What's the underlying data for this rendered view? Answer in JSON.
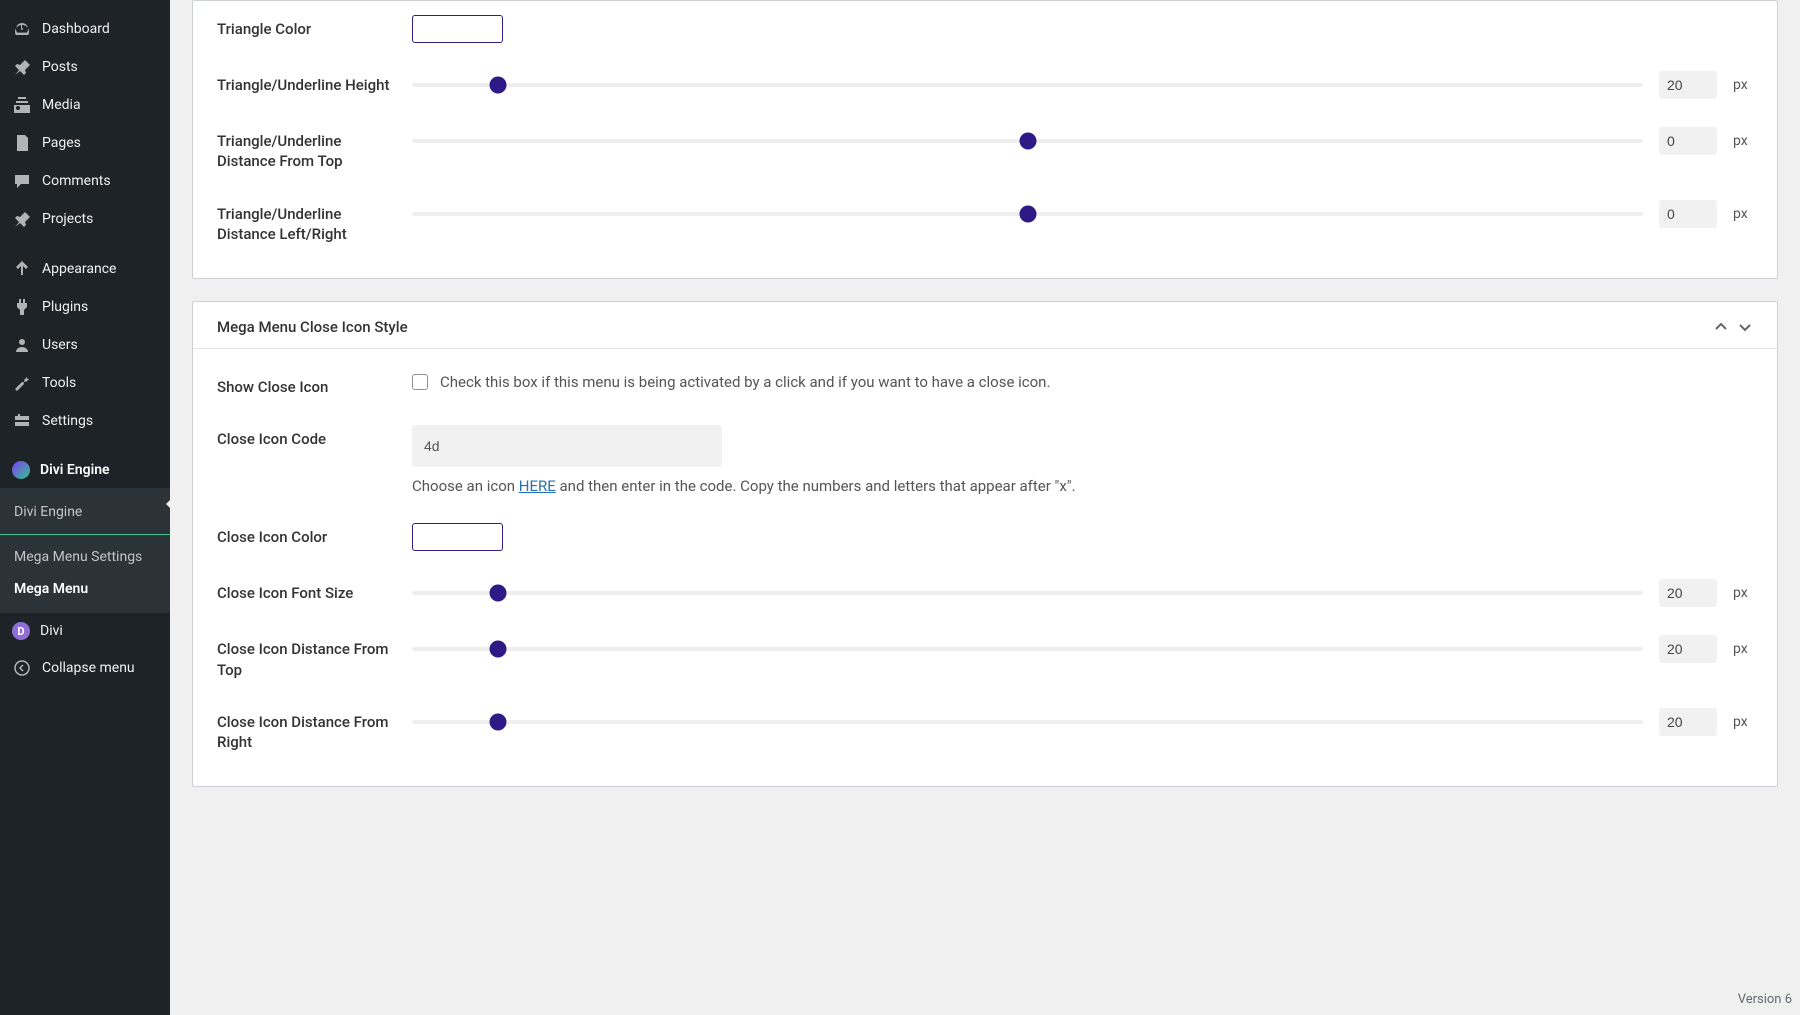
{
  "sidebar": {
    "items": [
      {
        "icon": "dashboard",
        "label": "Dashboard"
      },
      {
        "icon": "pin",
        "label": "Posts"
      },
      {
        "icon": "media",
        "label": "Media"
      },
      {
        "icon": "pages",
        "label": "Pages"
      },
      {
        "icon": "comments",
        "label": "Comments"
      },
      {
        "icon": "pin",
        "label": "Projects"
      },
      {
        "icon": "appearance",
        "label": "Appearance"
      },
      {
        "icon": "plugins",
        "label": "Plugins"
      },
      {
        "icon": "users",
        "label": "Users"
      },
      {
        "icon": "tools",
        "label": "Tools"
      },
      {
        "icon": "settings",
        "label": "Settings"
      }
    ],
    "divi_engine": {
      "label": "Divi Engine"
    },
    "submenu": [
      {
        "label": "Divi Engine"
      },
      {
        "label": "Mega Menu Settings"
      },
      {
        "label": "Mega Menu"
      }
    ],
    "divi": {
      "label": "Divi"
    },
    "collapse": {
      "label": "Collapse menu"
    }
  },
  "panel1": {
    "fields": {
      "triangle_color": {
        "label": "Triangle Color"
      },
      "triangle_height": {
        "label": "Triangle/Underline Height",
        "value": "20",
        "unit": "px",
        "pct": 7
      },
      "triangle_top": {
        "label": "Triangle/Underline Distance From Top",
        "value": "0",
        "unit": "px",
        "pct": 50
      },
      "triangle_lr": {
        "label": "Triangle/Underline Distance Left/Right",
        "value": "0",
        "unit": "px",
        "pct": 50
      }
    }
  },
  "panel2": {
    "title": "Mega Menu Close Icon Style",
    "fields": {
      "show_close": {
        "label": "Show Close Icon",
        "desc": "Check this box if this menu is being activated by a click and if you want to have a close icon."
      },
      "icon_code": {
        "label": "Close Icon Code",
        "value": "4d",
        "help_pre": "Choose an icon ",
        "help_link": "HERE",
        "help_post": " and then enter in the code. Copy the numbers and letters that appear after \"x\"."
      },
      "icon_color": {
        "label": "Close Icon Color"
      },
      "icon_size": {
        "label": "Close Icon Font Size",
        "value": "20",
        "unit": "px",
        "pct": 7
      },
      "icon_top": {
        "label": "Close Icon Distance From Top",
        "value": "20",
        "unit": "px",
        "pct": 7
      },
      "icon_right": {
        "label": "Close Icon Distance From Right",
        "value": "20",
        "unit": "px",
        "pct": 7
      }
    }
  },
  "version": "Version 6"
}
